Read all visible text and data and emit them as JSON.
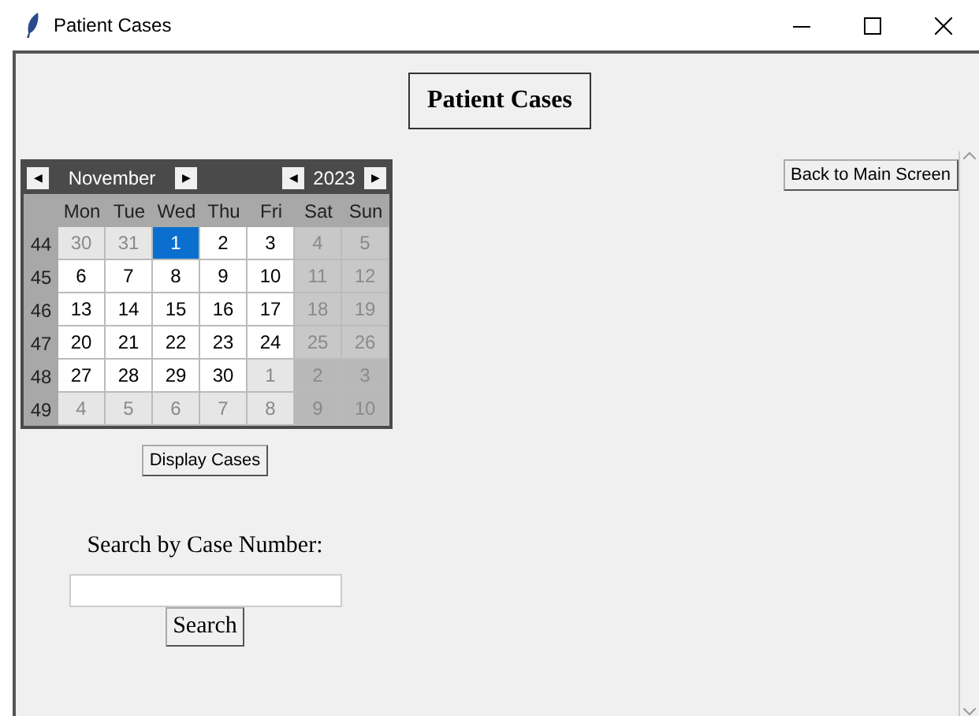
{
  "window": {
    "title": "Patient Cases"
  },
  "heading": "Patient Cases",
  "back_button": "Back to Main Screen",
  "calendar": {
    "month": "November",
    "year": "2023",
    "prev_month": "◀",
    "next_month": "▶",
    "prev_year": "◀",
    "next_year": "▶",
    "weekdays": [
      "Mon",
      "Tue",
      "Wed",
      "Thu",
      "Fri",
      "Sat",
      "Sun"
    ],
    "weeks": [
      {
        "number": "44",
        "days": [
          {
            "label": "30",
            "in_month": false,
            "selected": false
          },
          {
            "label": "31",
            "in_month": false,
            "selected": false
          },
          {
            "label": "1",
            "in_month": true,
            "selected": true
          },
          {
            "label": "2",
            "in_month": true,
            "selected": false
          },
          {
            "label": "3",
            "in_month": true,
            "selected": false
          },
          {
            "label": "4",
            "in_month": true,
            "selected": false
          },
          {
            "label": "5",
            "in_month": true,
            "selected": false
          }
        ]
      },
      {
        "number": "45",
        "days": [
          {
            "label": "6",
            "in_month": true,
            "selected": false
          },
          {
            "label": "7",
            "in_month": true,
            "selected": false
          },
          {
            "label": "8",
            "in_month": true,
            "selected": false
          },
          {
            "label": "9",
            "in_month": true,
            "selected": false
          },
          {
            "label": "10",
            "in_month": true,
            "selected": false
          },
          {
            "label": "11",
            "in_month": true,
            "selected": false
          },
          {
            "label": "12",
            "in_month": true,
            "selected": false
          }
        ]
      },
      {
        "number": "46",
        "days": [
          {
            "label": "13",
            "in_month": true,
            "selected": false
          },
          {
            "label": "14",
            "in_month": true,
            "selected": false
          },
          {
            "label": "15",
            "in_month": true,
            "selected": false
          },
          {
            "label": "16",
            "in_month": true,
            "selected": false
          },
          {
            "label": "17",
            "in_month": true,
            "selected": false
          },
          {
            "label": "18",
            "in_month": true,
            "selected": false
          },
          {
            "label": "19",
            "in_month": true,
            "selected": false
          }
        ]
      },
      {
        "number": "47",
        "days": [
          {
            "label": "20",
            "in_month": true,
            "selected": false
          },
          {
            "label": "21",
            "in_month": true,
            "selected": false
          },
          {
            "label": "22",
            "in_month": true,
            "selected": false
          },
          {
            "label": "23",
            "in_month": true,
            "selected": false
          },
          {
            "label": "24",
            "in_month": true,
            "selected": false
          },
          {
            "label": "25",
            "in_month": true,
            "selected": false
          },
          {
            "label": "26",
            "in_month": true,
            "selected": false
          }
        ]
      },
      {
        "number": "48",
        "days": [
          {
            "label": "27",
            "in_month": true,
            "selected": false
          },
          {
            "label": "28",
            "in_month": true,
            "selected": false
          },
          {
            "label": "29",
            "in_month": true,
            "selected": false
          },
          {
            "label": "30",
            "in_month": true,
            "selected": false
          },
          {
            "label": "1",
            "in_month": false,
            "selected": false
          },
          {
            "label": "2",
            "in_month": false,
            "selected": false
          },
          {
            "label": "3",
            "in_month": false,
            "selected": false
          }
        ]
      },
      {
        "number": "49",
        "days": [
          {
            "label": "4",
            "in_month": false,
            "selected": false
          },
          {
            "label": "5",
            "in_month": false,
            "selected": false
          },
          {
            "label": "6",
            "in_month": false,
            "selected": false
          },
          {
            "label": "7",
            "in_month": false,
            "selected": false
          },
          {
            "label": "8",
            "in_month": false,
            "selected": false
          },
          {
            "label": "9",
            "in_month": false,
            "selected": false
          },
          {
            "label": "10",
            "in_month": false,
            "selected": false
          }
        ]
      }
    ]
  },
  "display_button": "Display Cases",
  "search_label": "Search by Case Number:",
  "search_button": "Search"
}
